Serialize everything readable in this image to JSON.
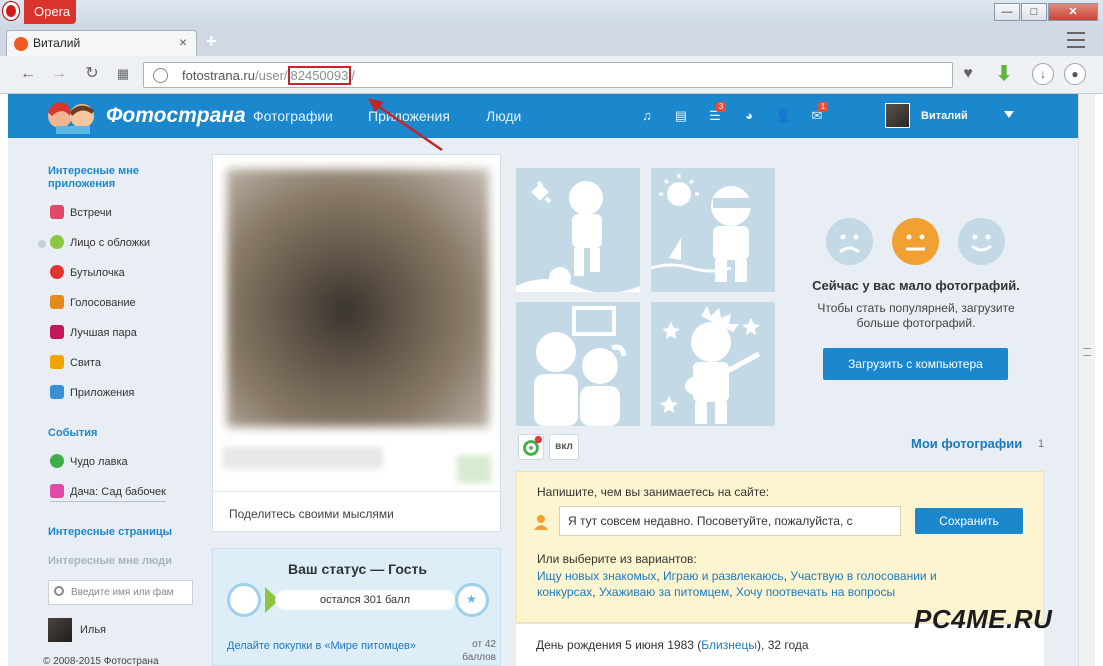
{
  "browser": {
    "name": "Opera",
    "tab_title": "Виталий",
    "url_domain": "fotostrana.ru",
    "url_path_pre": "/user/",
    "url_id": "82450093",
    "url_path_post": "/"
  },
  "site": {
    "logo_text": "Фотострана",
    "nav": [
      "Фотографии",
      "Приложения",
      "Люди"
    ],
    "badges": {
      "list": "3",
      "mail": "1"
    },
    "user_name": "Виталий"
  },
  "sidebar": {
    "apps_heading": "Интересные мне приложения",
    "apps": [
      {
        "label": "Встречи",
        "icon": "meetings-icon",
        "color": "#e04a6a"
      },
      {
        "label": "Лицо с обложки",
        "icon": "medal-icon",
        "color": "#8dc63f"
      },
      {
        "label": "Бутылочка",
        "icon": "heart-bottle-icon",
        "color": "#e0342f"
      },
      {
        "label": "Голосование",
        "icon": "crown-icon",
        "color": "#e88a1a"
      },
      {
        "label": "Лучшая пара",
        "icon": "couple-heart-icon",
        "color": "#c2185b"
      },
      {
        "label": "Свита",
        "icon": "retinue-crown-icon",
        "color": "#f0a400"
      },
      {
        "label": "Приложения",
        "icon": "gamepad-icon",
        "color": "#3a8ed6"
      }
    ],
    "events_heading": "События",
    "events": [
      {
        "label": "Чудо лавка",
        "icon": "swirl-icon",
        "color": "#3fae49"
      },
      {
        "label": "Дача: Сад бабочек",
        "icon": "butterfly-icon",
        "color": "#e04aa6"
      }
    ],
    "pages_heading": "Интересные страницы",
    "people_heading": "Интересные мне люди",
    "search_placeholder": "Введите имя или фам",
    "friend_name": "Илья",
    "copyright": "© 2008-2015 Фотострана"
  },
  "profile": {
    "thoughts_placeholder": "Поделитесь своими мыслями",
    "status_title": "Ваш статус — Гость",
    "status_progress_text": "остался 301 балл",
    "status_link": "Делайте покупки в «Мире питомцев»",
    "status_points": "от 42 баллов",
    "vkl_label": "вкл"
  },
  "photos": {
    "few_title": "Сейчас у вас мало фотографий.",
    "few_sub": "Чтобы стать популярней, загрузите больше фотографий.",
    "upload_label": "Загрузить с компьютера",
    "my_photos_label": "Мои фотографии",
    "my_photos_count": "1"
  },
  "activity": {
    "question": "Напишите, чем вы занимаетесь на сайте:",
    "input_value": "Я тут совсем недавно. Посоветуйте, пожалуйста, с",
    "save_label": "Сохранить",
    "or_label": "Или выберите из вариантов:",
    "options": [
      "Ищу новых знакомых",
      "Играю и развлекаюсь",
      "Участвую в голосовании и конкурсах",
      "Ухаживаю за питомцем",
      "Хочу поотвечать на вопросы"
    ]
  },
  "birthday": {
    "prefix": "День рождения 5 июня 1983 (",
    "sign": "Близнецы",
    "suffix": "), 32 года"
  },
  "watermark": "PC4ME.RU",
  "colors": {
    "brand": "#1b87cc",
    "accent_red": "#c0262b",
    "sad": "#c3d9e6",
    "neutral": "#f0a132"
  }
}
